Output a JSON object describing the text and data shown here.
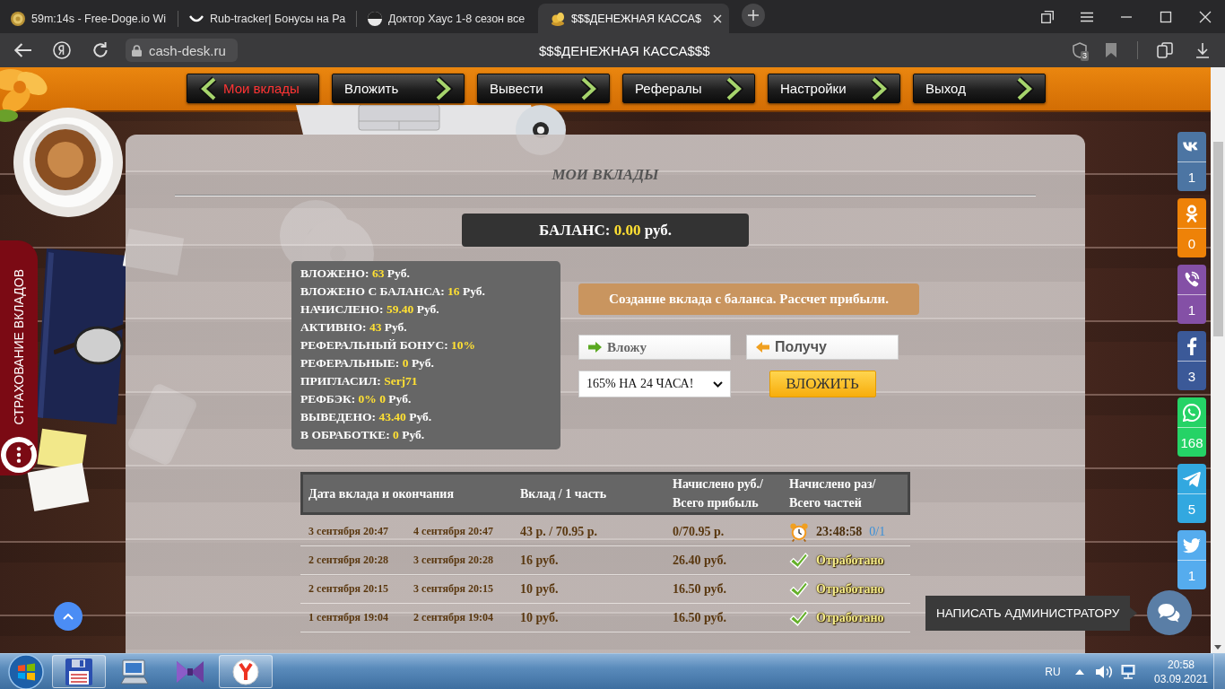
{
  "browser": {
    "tabs": [
      {
        "title": "59m:14s - Free-Doge.io Wi",
        "selected": false
      },
      {
        "title": "Rub-tracker| Бонусы на Ра",
        "selected": false
      },
      {
        "title": "Доктор Хаус 1-8 сезон все",
        "selected": false
      },
      {
        "title": "$$$ДЕНЕЖНАЯ КАССА$",
        "selected": true
      }
    ],
    "address": "cash-desk.ru",
    "page_title": "$$$ДЕНЕЖНАЯ КАССА$$$",
    "shield_badge": "3"
  },
  "nav": [
    {
      "label": "Мои вклады",
      "selected": true
    },
    {
      "label": "Вложить",
      "selected": false
    },
    {
      "label": "Вывести",
      "selected": false
    },
    {
      "label": "Рефералы",
      "selected": false
    },
    {
      "label": "Настройки",
      "selected": false
    },
    {
      "label": "Выход",
      "selected": false
    }
  ],
  "panel": {
    "title": "МОИ ВКЛАДЫ",
    "balance": {
      "label": "БАЛАНС:",
      "value": "0.00",
      "unit": "руб."
    },
    "stats": [
      {
        "label": "ВЛОЖЕНО:",
        "value": "63",
        "unit": "Руб."
      },
      {
        "label": "ВЛОЖЕНО С БАЛАНСА:",
        "value": "16",
        "unit": "Руб."
      },
      {
        "label": "НАЧИСЛЕНО:",
        "value": "59.40",
        "unit": "Руб."
      },
      {
        "label": "АКТИВНО:",
        "value": "43",
        "unit": "Руб."
      },
      {
        "label": "РЕФЕРАЛЬНЫЙ БОНУС:",
        "value": "10%"
      },
      {
        "label": "РЕФЕРАЛЬНЫЕ:",
        "value": "0",
        "unit": "Руб."
      },
      {
        "label": "ПРИГЛАСИЛ:",
        "value": "Serj71"
      },
      {
        "label": "РЕФБЭК:",
        "value": "0% 0",
        "unit": "Руб."
      },
      {
        "label": "ВЫВЕДЕНО:",
        "value": "43.40",
        "unit": "Руб."
      },
      {
        "label": "В ОБРАБОТКЕ:",
        "value": "0",
        "unit": "Руб."
      }
    ],
    "form": {
      "header": "Создание вклада с баланса. Рассчет прибыли.",
      "fields": [
        {
          "kind": "in",
          "placeholder": "Вложу"
        },
        {
          "kind": "out",
          "placeholder": "Получу"
        }
      ],
      "plan": "165% НА 24 ЧАСА!",
      "submit": "ВЛОЖИТЬ"
    },
    "table": {
      "columns": [
        "Дата вклада и окончания",
        "Вклад / 1 часть",
        "Начислено руб./ Всего прибыль",
        "Начислено раз/ Всего частей"
      ],
      "rows": [
        {
          "start": "3 сентября 20:47",
          "end": "4 сентября 20:47",
          "amount": "43 р. / 70.95 р.",
          "accrued": "0/70.95 р.",
          "status": {
            "kind": "timer",
            "text": "23:48:58",
            "parts": "0/1"
          }
        },
        {
          "start": "2 сентября 20:28",
          "end": "3 сентября 20:28",
          "amount": "16 руб.",
          "accrued": "26.40 руб.",
          "status": {
            "kind": "done",
            "text": "Отработано"
          }
        },
        {
          "start": "2 сентября 20:15",
          "end": "3 сентября 20:15",
          "amount": "10 руб.",
          "accrued": "16.50 руб.",
          "status": {
            "kind": "done",
            "text": "Отработано"
          }
        },
        {
          "start": "1 сентября 19:04",
          "end": "2 сентября 19:04",
          "amount": "10 руб.",
          "accrued": "16.50 руб.",
          "status": {
            "kind": "done",
            "text": "Отработано"
          }
        }
      ]
    }
  },
  "insurance_tab": {
    "label": "СТРАХОВАНИЕ ВКЛАДОВ"
  },
  "social": [
    {
      "kind": "vk",
      "color": "#4c75a3",
      "count": "1"
    },
    {
      "kind": "ok",
      "color": "#ee8208",
      "count": "0"
    },
    {
      "kind": "viber",
      "color": "#8450a6",
      "count": "1"
    },
    {
      "kind": "facebook",
      "color": "#3b5998",
      "count": "3"
    },
    {
      "kind": "whatsapp",
      "color": "#25d366",
      "count": "168"
    },
    {
      "kind": "telegram",
      "color": "#32a8e0",
      "count": "5"
    },
    {
      "kind": "twitter",
      "color": "#55acee",
      "count": "1"
    }
  ],
  "chat": {
    "tooltip": "НАПИСАТЬ АДМИНИСТРАТОРУ"
  },
  "taskbar": {
    "apps": [
      {
        "running": true
      },
      {
        "running": false
      },
      {
        "running": false
      },
      {
        "running": true
      }
    ],
    "language": "RU",
    "time": "20:58",
    "date": "03.09.2021"
  }
}
